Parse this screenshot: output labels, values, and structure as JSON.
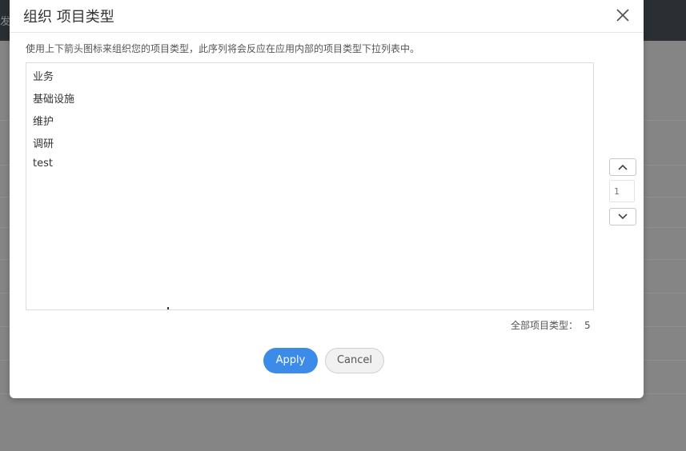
{
  "background": {
    "topbar_text": "发"
  },
  "dialog": {
    "title": "组织 项目类型",
    "description": "使用上下箭头图标来组织您的项目类型，此序列将会反应在应用内部的项目类型下拉列表中。",
    "close_icon": "close-icon",
    "items": [
      {
        "label": "业务"
      },
      {
        "label": "基础设施"
      },
      {
        "label": "维护"
      },
      {
        "label": "调研"
      },
      {
        "label": "test"
      }
    ],
    "move_up_icon": "chevron-up-icon",
    "move_down_icon": "chevron-down-icon",
    "position_placeholder": "1",
    "total_label": "全部项目类型：",
    "total_count": "5",
    "apply_label": "Apply",
    "cancel_label": "Cancel"
  },
  "colors": {
    "accent": "#3d8be8",
    "overlay": "#7f7f7f",
    "topbar": "#2b2f33"
  }
}
